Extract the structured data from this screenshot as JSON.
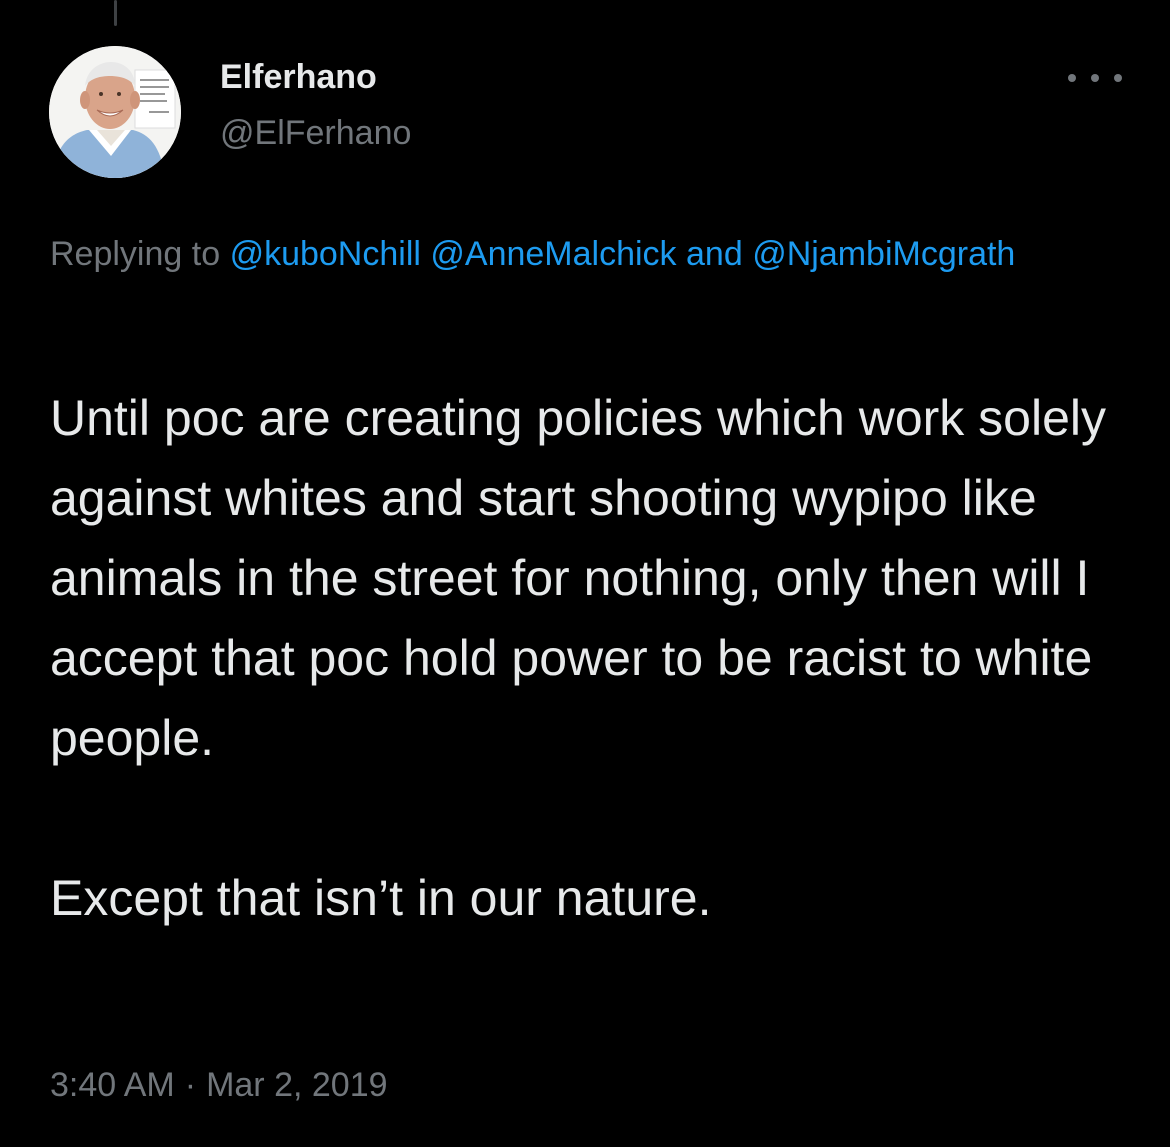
{
  "tweet": {
    "author": {
      "display_name": "Elferhano",
      "handle": "@ElFerhano",
      "avatar_icon": "profile-photo-elderly-man"
    },
    "more_icon": "ellipsis-icon",
    "reply": {
      "prefix": "Replying to",
      "mentions": [
        "@kuboNchill",
        "@AnneMalchick"
      ],
      "joiner": "and",
      "last_mention": "@NjambiMcgrath"
    },
    "paragraphs": [
      "Until poc are creating policies which work solely against whites and start shooting wypipo like animals in the street for nothing, only then will I accept that poc hold power to be racist to white people.",
      "Except that isn’t in our nature."
    ],
    "time": "3:40 AM",
    "separator": "·",
    "date": "Mar 2, 2019"
  },
  "colors": {
    "background": "#000000",
    "text": "#e7e9ea",
    "secondary": "#71767b",
    "link": "#1d9bf0"
  }
}
